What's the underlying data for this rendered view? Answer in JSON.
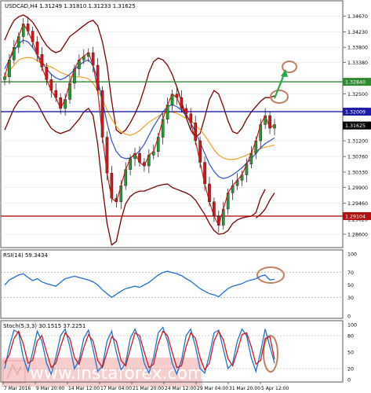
{
  "chart_data": [
    {
      "type": "candlestick",
      "title": "USDCAD,H4 1.31249 1.31810 1.31233 1.31625",
      "ylim": [
        1.2825,
        1.3505
      ],
      "y_ticks": [
        "1.34670",
        "1.34230",
        "1.33800",
        "1.33380",
        "1.32500",
        "1.32080",
        "1.31200",
        "1.30760",
        "1.30330",
        "1.29900",
        "1.29460",
        "1.29020",
        "1.28600"
      ],
      "x_ticks": [
        "7 Mar 2016",
        "9 Mar 20:00",
        "14 Mar 12:00",
        "17 Mar 04:00",
        "21 Mar 20:00",
        "24 Mar 12:00",
        "29 Mar 04:00",
        "31 Mar 20:00",
        "5 Apr 12:00"
      ],
      "horizontal_lines": [
        {
          "label": "1.32840",
          "value": 1.3284,
          "color": "#2e8b2e"
        },
        {
          "label": "1.32009",
          "value": 1.32009,
          "color": "#1a1aa6"
        },
        {
          "label": "1.29104",
          "value": 1.29104,
          "color": "#b01010"
        }
      ],
      "last_price": {
        "label": "1.31625",
        "value": 1.31625
      },
      "close_path": [
        1.3298,
        1.3345,
        1.338,
        1.341,
        1.3445,
        1.3425,
        1.3395,
        1.336,
        1.3325,
        1.329,
        1.326,
        1.324,
        1.321,
        1.3235,
        1.328,
        1.332,
        1.3345,
        1.3355,
        1.3365,
        1.333,
        1.326,
        1.313,
        1.303,
        1.296,
        1.295,
        1.2995,
        1.304,
        1.307,
        1.3085,
        1.306,
        1.305,
        1.308,
        1.309,
        1.313,
        1.318,
        1.322,
        1.325,
        1.324,
        1.321,
        1.3195,
        1.317,
        1.312,
        1.306,
        1.3,
        1.295,
        1.291,
        1.2885,
        1.293,
        1.2975,
        1.2995,
        1.301,
        1.3025,
        1.3055,
        1.3085,
        1.312,
        1.3165,
        1.319,
        1.3155,
        1.3165
      ],
      "series": [
        {
          "name": "",
          "kind": "bollinger-upper",
          "color": "#7a0000",
          "values": [
            1.34,
            1.343,
            1.3455,
            1.3465,
            1.347,
            1.3462,
            1.345,
            1.343,
            1.3405,
            1.3385,
            1.3372,
            1.3365,
            1.337,
            1.339,
            1.341,
            1.342,
            1.343,
            1.344,
            1.345,
            1.3455,
            1.344,
            1.3395,
            1.333,
            1.323,
            1.315,
            1.314,
            1.315,
            1.317,
            1.3195,
            1.3225,
            1.3265,
            1.331,
            1.334,
            1.335,
            1.3345,
            1.333,
            1.3305,
            1.327,
            1.323,
            1.3185,
            1.315,
            1.313,
            1.314,
            1.3185,
            1.3235,
            1.326,
            1.325,
            1.3215,
            1.3175,
            1.3145,
            1.314,
            1.3155,
            1.318,
            1.32,
            1.3215,
            1.323,
            1.324,
            1.324,
            1.3245
          ]
        },
        {
          "name": "",
          "kind": "bollinger-lower",
          "color": "#7a0000",
          "values": [
            1.315,
            1.318,
            1.321,
            1.323,
            1.324,
            1.3245,
            1.324,
            1.3225,
            1.32,
            1.3175,
            1.3155,
            1.3145,
            1.314,
            1.3145,
            1.315,
            1.3165,
            1.318,
            1.32,
            1.321,
            1.319,
            1.311,
            1.299,
            1.289,
            1.283,
            1.284,
            1.29,
            1.2945,
            1.2965,
            1.2975,
            1.298,
            1.298,
            1.2985,
            1.299,
            1.2995,
            1.2998,
            1.3,
            1.299,
            1.2985,
            1.298,
            1.2975,
            1.2968,
            1.2955,
            1.2935,
            1.2915,
            1.289,
            1.287,
            1.286,
            1.2862,
            1.287,
            1.289,
            1.29,
            1.2905,
            1.2908,
            1.291,
            1.292,
            1.296,
            1.2985,
            null,
            null
          ]
        },
        {
          "name": "",
          "kind": "bollinger-lower-tail",
          "color": "#7a0000",
          "values": [
            null,
            null,
            null,
            null,
            null,
            null,
            null,
            null,
            null,
            null,
            null,
            null,
            null,
            null,
            null,
            null,
            null,
            null,
            null,
            null,
            null,
            null,
            null,
            null,
            null,
            null,
            null,
            null,
            null,
            null,
            null,
            null,
            null,
            null,
            null,
            null,
            null,
            null,
            null,
            null,
            null,
            null,
            null,
            null,
            null,
            null,
            null,
            null,
            null,
            null,
            null,
            null,
            null,
            null,
            1.2905,
            1.2915,
            1.293,
            1.2955,
            1.2975
          ]
        },
        {
          "name": "",
          "kind": "moving-average-slow",
          "color": "#f0a020",
          "values": [
            1.329,
            1.3315,
            1.333,
            1.3345,
            1.335,
            1.3352,
            1.335,
            1.3343,
            1.3335,
            1.333,
            1.3325,
            1.3318,
            1.331,
            1.3305,
            1.33,
            1.3298,
            1.3298,
            1.3296,
            1.3292,
            1.328,
            1.326,
            1.3235,
            1.3205,
            1.318,
            1.316,
            1.3145,
            1.3138,
            1.3135,
            1.314,
            1.3148,
            1.316,
            1.3172,
            1.318,
            1.3188,
            1.3195,
            1.32,
            1.32,
            1.3196,
            1.319,
            1.3182,
            1.3175,
            1.3165,
            1.315,
            1.3135,
            1.3115,
            1.3095,
            1.308,
            1.3072,
            1.3068,
            1.3068,
            1.307,
            1.3075,
            1.308,
            1.3086,
            1.3092,
            1.3098,
            1.3102,
            1.3105,
            1.3108
          ]
        },
        {
          "name": "",
          "kind": "moving-average-fast",
          "color": "#3050c8",
          "values": [
            1.332,
            1.3345,
            1.337,
            1.339,
            1.34,
            1.3395,
            1.338,
            1.336,
            1.334,
            1.332,
            1.3305,
            1.3295,
            1.329,
            1.3295,
            1.3305,
            1.3318,
            1.333,
            1.334,
            1.3345,
            1.333,
            1.329,
            1.323,
            1.317,
            1.312,
            1.309,
            1.3075,
            1.307,
            1.3072,
            1.308,
            1.3092,
            1.311,
            1.3135,
            1.316,
            1.318,
            1.32,
            1.3215,
            1.322,
            1.3215,
            1.3205,
            1.319,
            1.317,
            1.3145,
            1.3115,
            1.3085,
            1.3055,
            1.3035,
            1.302,
            1.3015,
            1.3018,
            1.3025,
            1.3035,
            1.3045,
            1.3058,
            1.307,
            1.3085,
            1.31,
            1.3112,
            1.312,
            1.3128
          ]
        }
      ]
    },
    {
      "type": "line",
      "title": "RSI(14) 59.3434",
      "ylim": [
        0,
        100
      ],
      "y_ticks": [
        "100",
        "70",
        "50",
        "30",
        "0"
      ],
      "series": [
        {
          "name": "",
          "color": "#1f6fd0",
          "values": [
            50,
            58,
            62,
            66,
            68,
            62,
            57,
            60,
            55,
            52,
            50,
            48,
            54,
            60,
            62,
            64,
            62,
            60,
            58,
            55,
            50,
            42,
            36,
            30,
            35,
            40,
            44,
            46,
            48,
            46,
            50,
            54,
            60,
            66,
            70,
            72,
            70,
            68,
            65,
            60,
            56,
            50,
            44,
            40,
            36,
            34,
            31,
            38,
            44,
            48,
            50,
            52,
            56,
            58,
            60,
            64,
            66,
            58,
            59
          ]
        }
      ]
    },
    {
      "type": "line",
      "title": "Stoch(5,3,3) 30.1515 37.2251",
      "ylim": [
        0,
        100
      ],
      "y_ticks": [
        "100",
        "80",
        "50",
        "20",
        "0"
      ],
      "series": [
        {
          "name": "",
          "color": "#1f6fd0",
          "values": [
            20,
            60,
            90,
            85,
            40,
            15,
            50,
            88,
            70,
            30,
            10,
            40,
            80,
            92,
            60,
            20,
            35,
            75,
            90,
            55,
            15,
            25,
            70,
            88,
            50,
            18,
            30,
            75,
            92,
            70,
            30,
            12,
            40,
            85,
            95,
            70,
            30,
            10,
            35,
            80,
            92,
            60,
            20,
            12,
            45,
            85,
            90,
            55,
            20,
            30,
            70,
            92,
            80,
            40,
            15,
            50,
            92,
            60,
            30
          ]
        },
        {
          "name": "",
          "color": "#d01818",
          "values": [
            30,
            45,
            75,
            88,
            65,
            30,
            35,
            70,
            80,
            50,
            22,
            30,
            60,
            85,
            75,
            40,
            28,
            58,
            82,
            70,
            35,
            22,
            50,
            78,
            70,
            35,
            25,
            55,
            85,
            80,
            50,
            22,
            28,
            65,
            88,
            80,
            50,
            22,
            25,
            60,
            85,
            75,
            40,
            18,
            30,
            70,
            88,
            72,
            38,
            25,
            52,
            82,
            85,
            60,
            28,
            35,
            75,
            78,
            37
          ]
        }
      ]
    }
  ],
  "watermark": {
    "text": "www.instaforex.com",
    "logo_name": "instaforex-logo"
  }
}
